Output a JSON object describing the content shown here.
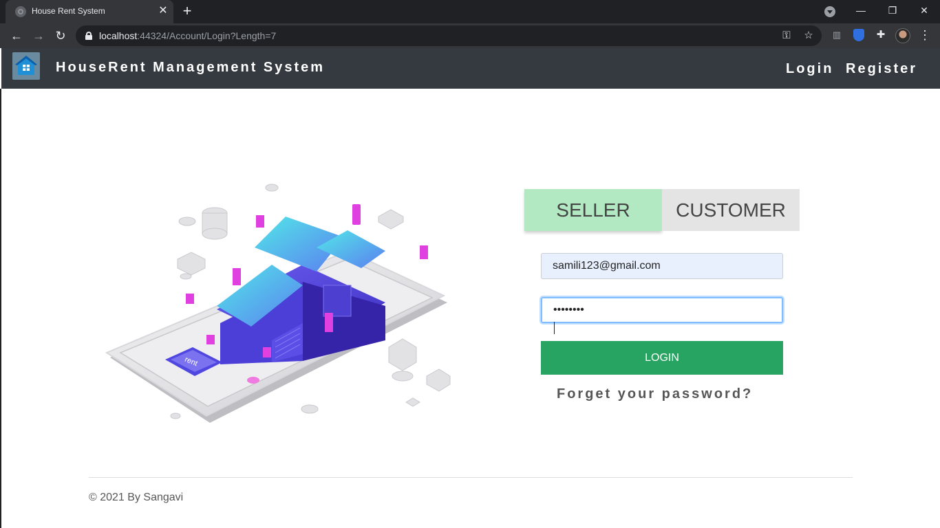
{
  "browser": {
    "tab_title": "House Rent System",
    "tab_close": "✕",
    "new_tab": "+",
    "url_host": "localhost",
    "url_path": ":44324/Account/Login?Length=7",
    "window_controls": {
      "minimize": "—",
      "restore": "❐",
      "close": "✕"
    }
  },
  "site": {
    "brand": "HouseRent Management System",
    "nav": {
      "login": "Login",
      "register": "Register"
    }
  },
  "login_form": {
    "tabs": {
      "seller": "SELLER",
      "customer": "CUSTOMER"
    },
    "email_value": "samili123@gmail.com",
    "password_masked": "••••••••",
    "submit_label": "LOGIN",
    "forgot_link": "Forget your password?"
  },
  "footer": {
    "copyright": "© 2021 By Sangavi"
  },
  "colors": {
    "navbar": "#343a40",
    "seller_tab": "#b2e8c2",
    "customer_tab": "#e4e4e4",
    "login_button": "#28a462",
    "email_autofill": "#e8f0fe",
    "focus_border": "#80bdff"
  }
}
